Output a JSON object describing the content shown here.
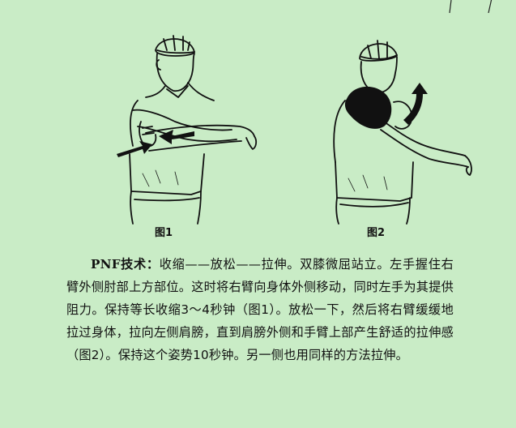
{
  "figures": [
    {
      "caption": "图1"
    },
    {
      "caption": "图2"
    }
  ],
  "body": {
    "lead": "PNF技术：",
    "text": "收缩——放松——拉伸。双膝微屈站立。左手握住右臂外侧肘部上方部位。这时将右臂向身体外侧移动，同时左手为其提供阻力。保持等长收缩3～4秒钟（图1）。放松一下，然后将右臂缓缓地拉过身体，拉向左侧肩膀，直到肩膀外侧和手臂上部产生舒适的拉伸感（图2）。保持这个姿势10秒钟。另一侧也用同样的方法拉伸。"
  },
  "colors": {
    "background": "#c9ecc6",
    "ink": "#111111"
  }
}
